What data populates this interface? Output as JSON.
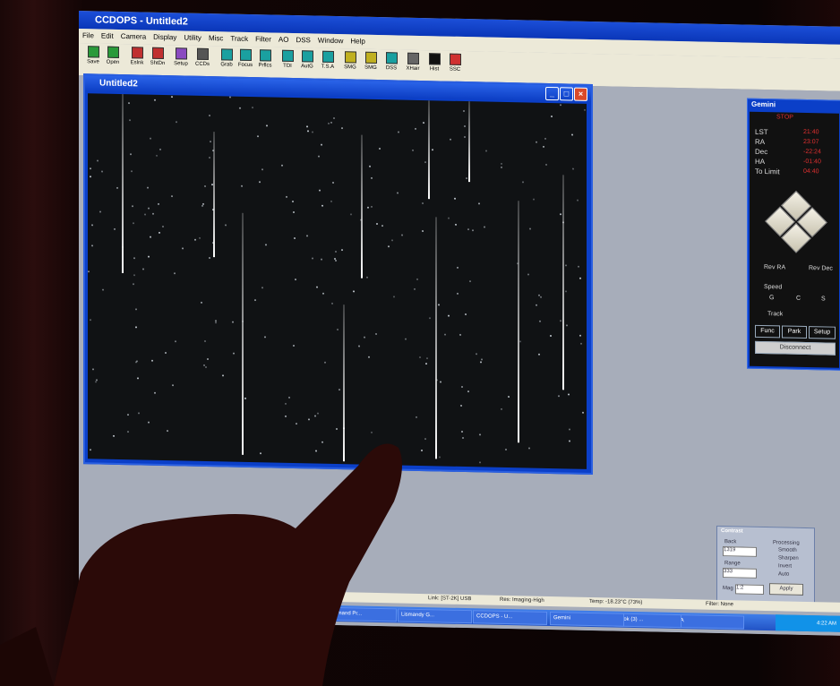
{
  "app": {
    "title": "CCDOPS - Untitled2"
  },
  "menu": [
    "File",
    "Edit",
    "Camera",
    "Display",
    "Utility",
    "Misc",
    "Track",
    "Filter",
    "AO",
    "DSS",
    "Window",
    "Help"
  ],
  "toolbar": [
    "Save",
    "Open",
    "Eslnk",
    "ShtDn",
    "Setup",
    "CCDs",
    "Grab",
    "Focus",
    "Prflcs",
    "TDI",
    "AutG",
    "T.S.A",
    "SMG",
    "SMG",
    "DSS",
    "XHair",
    "Hist",
    "SSC"
  ],
  "image_window": {
    "title": "Untitled2"
  },
  "gemini": {
    "title": "Gemini",
    "labels": [
      "LST",
      "RA",
      "Dec",
      "HA",
      "To Limit"
    ],
    "values": [
      "21:40",
      "23:07",
      "-22:24",
      "-01:40",
      "04:40"
    ],
    "rev_ra": "Rev RA",
    "rev_dec": "Rev Dec",
    "speed": "Speed",
    "speed_opts": [
      "G",
      "C",
      "S"
    ],
    "track": "Track",
    "func": "Func",
    "park": "Park",
    "setup": "Setup",
    "disconnect": "Disconnect",
    "status": "STOP"
  },
  "contrast": {
    "title": "Contrast",
    "back": "Back",
    "back_val": "1319",
    "range": "Range",
    "range_val": "333",
    "processing": "Processing",
    "smooth": "Smooth",
    "sharpen": "Sharpen",
    "invert": "Invert",
    "auto": "Auto",
    "mag": "Mag",
    "mag_val": "1:2",
    "apply": "Apply"
  },
  "status": {
    "link": "Link: [ST-2K] USB",
    "res": "Res: Imaging-High",
    "temp": "Temp: -18.23°C (73%)",
    "filter": "Filter: None"
  },
  "taskbar": [
    "Command Pr...",
    "Lismandy G...",
    "CCDOPS - U...",
    "Gemini",
    "Outlook (3) ...",
    "C2A"
  ],
  "tray": {
    "time": "4:22 AM"
  }
}
